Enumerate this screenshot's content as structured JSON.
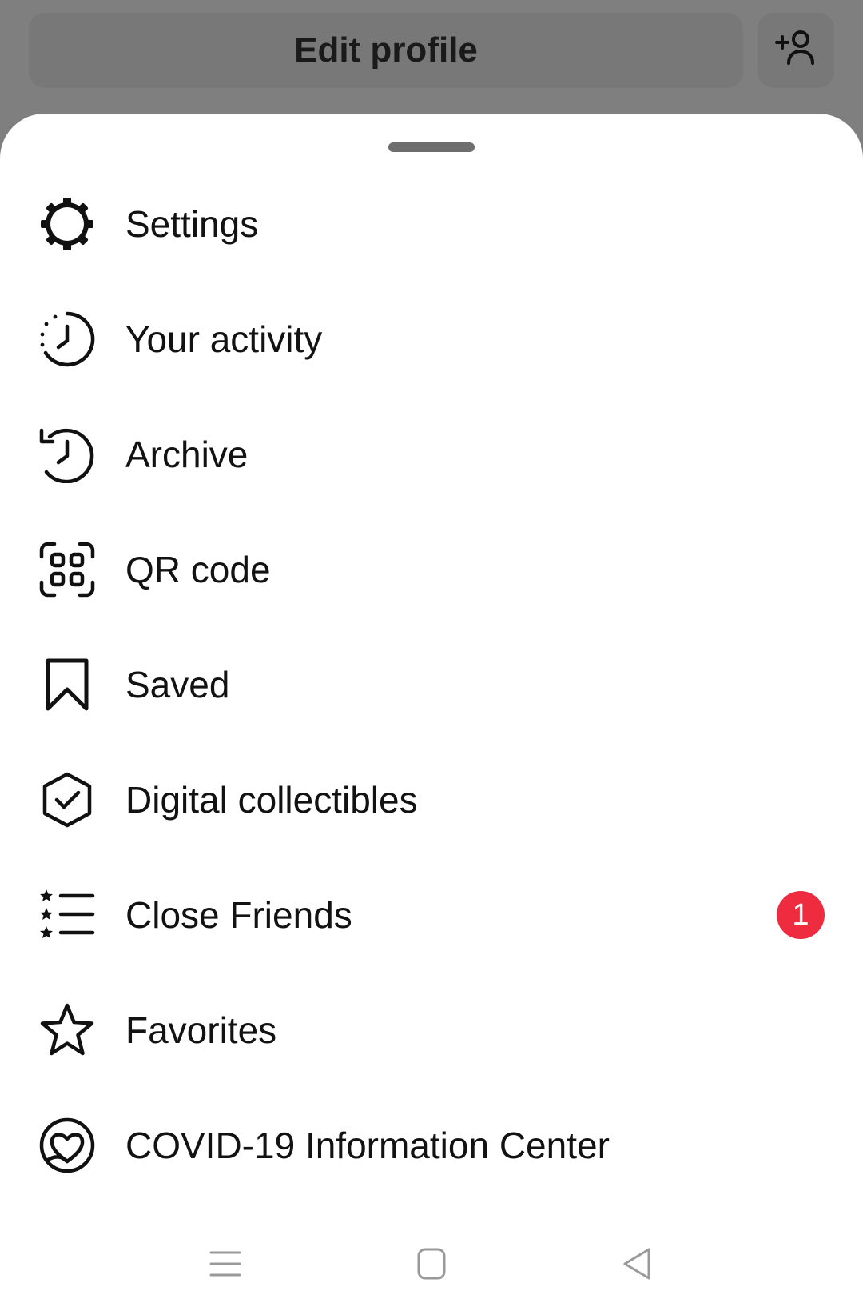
{
  "header": {
    "edit_profile_label": "Edit profile",
    "add_person_icon": "person-add-icon"
  },
  "menu": {
    "items": [
      {
        "label": "Settings",
        "icon": "settings-gear-icon"
      },
      {
        "label": "Your activity",
        "icon": "activity-clock-icon"
      },
      {
        "label": "Archive",
        "icon": "archive-history-icon"
      },
      {
        "label": "QR code",
        "icon": "qr-code-icon"
      },
      {
        "label": "Saved",
        "icon": "bookmark-icon"
      },
      {
        "label": "Digital collectibles",
        "icon": "hexagon-check-icon"
      },
      {
        "label": "Close Friends",
        "icon": "star-list-icon",
        "badge": "1"
      },
      {
        "label": "Favorites",
        "icon": "star-icon"
      },
      {
        "label": "COVID-19 Information Center",
        "icon": "heart-circle-icon"
      }
    ]
  },
  "navbar": {
    "recents_icon": "menu-lines-icon",
    "home_icon": "square-icon",
    "back_icon": "triangle-back-icon"
  },
  "colors": {
    "dimmed_background": "#7f7f7f",
    "sheet_background": "#ffffff",
    "badge": "#ef2b3f",
    "text": "#121212"
  }
}
